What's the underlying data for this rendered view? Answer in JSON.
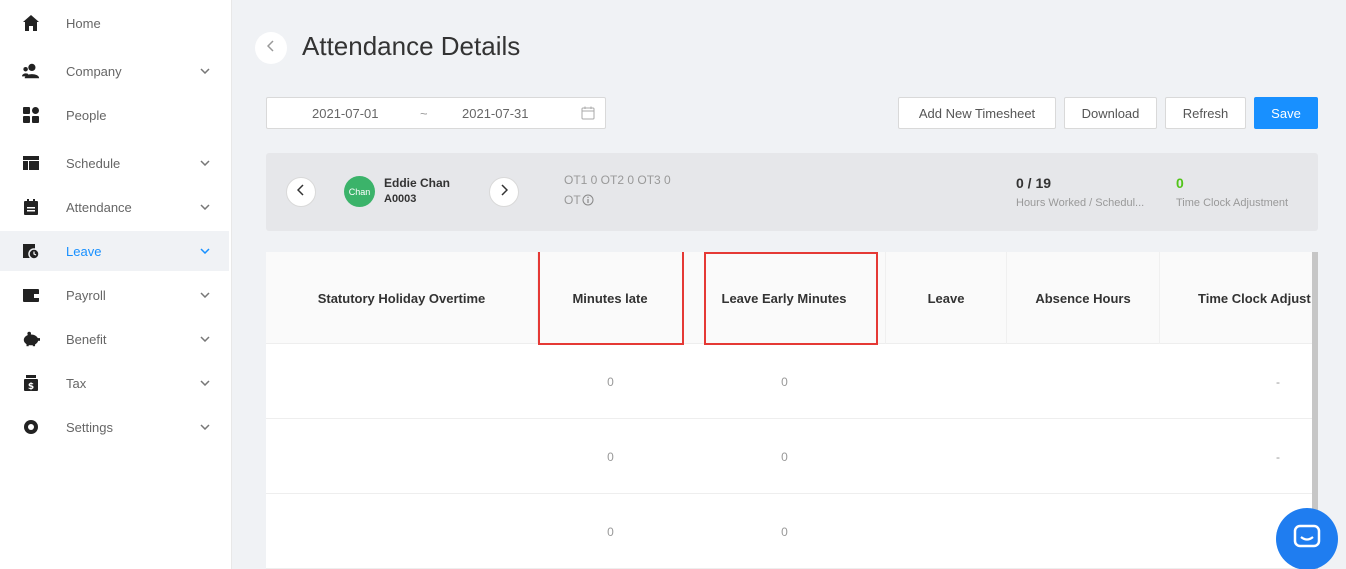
{
  "sidebar": {
    "items": [
      {
        "label": "Home",
        "icon": "home-icon",
        "chevron": false,
        "active": false
      },
      {
        "label": "Company",
        "icon": "company-icon",
        "chevron": true,
        "active": false
      },
      {
        "label": "People",
        "icon": "people-icon",
        "chevron": false,
        "active": false
      },
      {
        "label": "Schedule",
        "icon": "schedule-icon",
        "chevron": true,
        "active": false
      },
      {
        "label": "Attendance",
        "icon": "attendance-icon",
        "chevron": true,
        "active": false
      },
      {
        "label": "Leave",
        "icon": "leave-icon",
        "chevron": true,
        "active": true
      },
      {
        "label": "Payroll",
        "icon": "payroll-icon",
        "chevron": true,
        "active": false
      },
      {
        "label": "Benefit",
        "icon": "benefit-icon",
        "chevron": true,
        "active": false
      },
      {
        "label": "Tax",
        "icon": "tax-icon",
        "chevron": true,
        "active": false
      },
      {
        "label": "Settings",
        "icon": "settings-icon",
        "chevron": true,
        "active": false
      }
    ]
  },
  "header": {
    "title": "Attendance Details"
  },
  "toolbar": {
    "date_start": "2021-07-01",
    "date_separator": "~",
    "date_end": "2021-07-31",
    "add_timesheet_label": "Add New Timesheet",
    "download_label": "Download",
    "refresh_label": "Refresh",
    "save_label": "Save"
  },
  "employee": {
    "avatar_text": "Chan",
    "name": "Eddie Chan",
    "id": "A0003",
    "ot_summary": "OT1 0 OT2 0 OT3 0",
    "ot_label": "OT",
    "hours_value": "0 / 19",
    "hours_label": "Hours Worked / Schedul...",
    "tca_value": "0",
    "tca_label": "Time Clock Adjustment"
  },
  "table": {
    "columns": [
      "Statutory Holiday Overtime",
      "Minutes late",
      "Leave Early Minutes",
      "Leave",
      "Absence Hours",
      "Time Clock Adjust"
    ],
    "rows": [
      [
        "",
        "0",
        "0",
        "",
        "",
        "-"
      ],
      [
        "",
        "0",
        "0",
        "",
        "",
        "-"
      ],
      [
        "",
        "0",
        "0",
        "",
        "",
        "-"
      ]
    ]
  },
  "colors": {
    "primary": "#1890ff",
    "highlight": "#e53935",
    "success": "#52c41a",
    "avatar": "#3bb36a",
    "chat": "#1f7df0"
  }
}
